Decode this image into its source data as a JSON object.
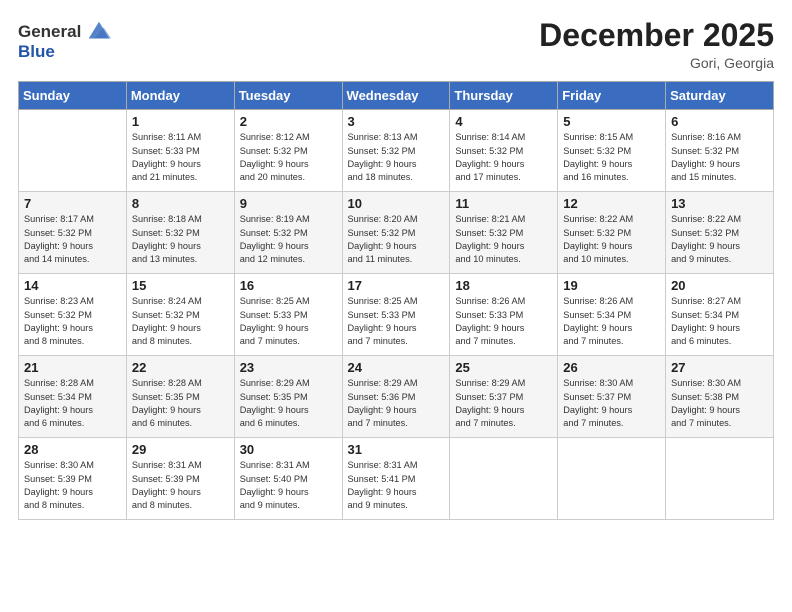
{
  "header": {
    "logo_general": "General",
    "logo_blue": "Blue",
    "month_title": "December 2025",
    "location": "Gori, Georgia"
  },
  "weekdays": [
    "Sunday",
    "Monday",
    "Tuesday",
    "Wednesday",
    "Thursday",
    "Friday",
    "Saturday"
  ],
  "weeks": [
    [
      {
        "day": "",
        "info": ""
      },
      {
        "day": "1",
        "info": "Sunrise: 8:11 AM\nSunset: 5:33 PM\nDaylight: 9 hours\nand 21 minutes."
      },
      {
        "day": "2",
        "info": "Sunrise: 8:12 AM\nSunset: 5:32 PM\nDaylight: 9 hours\nand 20 minutes."
      },
      {
        "day": "3",
        "info": "Sunrise: 8:13 AM\nSunset: 5:32 PM\nDaylight: 9 hours\nand 18 minutes."
      },
      {
        "day": "4",
        "info": "Sunrise: 8:14 AM\nSunset: 5:32 PM\nDaylight: 9 hours\nand 17 minutes."
      },
      {
        "day": "5",
        "info": "Sunrise: 8:15 AM\nSunset: 5:32 PM\nDaylight: 9 hours\nand 16 minutes."
      },
      {
        "day": "6",
        "info": "Sunrise: 8:16 AM\nSunset: 5:32 PM\nDaylight: 9 hours\nand 15 minutes."
      }
    ],
    [
      {
        "day": "7",
        "info": "Sunrise: 8:17 AM\nSunset: 5:32 PM\nDaylight: 9 hours\nand 14 minutes."
      },
      {
        "day": "8",
        "info": "Sunrise: 8:18 AM\nSunset: 5:32 PM\nDaylight: 9 hours\nand 13 minutes."
      },
      {
        "day": "9",
        "info": "Sunrise: 8:19 AM\nSunset: 5:32 PM\nDaylight: 9 hours\nand 12 minutes."
      },
      {
        "day": "10",
        "info": "Sunrise: 8:20 AM\nSunset: 5:32 PM\nDaylight: 9 hours\nand 11 minutes."
      },
      {
        "day": "11",
        "info": "Sunrise: 8:21 AM\nSunset: 5:32 PM\nDaylight: 9 hours\nand 10 minutes."
      },
      {
        "day": "12",
        "info": "Sunrise: 8:22 AM\nSunset: 5:32 PM\nDaylight: 9 hours\nand 10 minutes."
      },
      {
        "day": "13",
        "info": "Sunrise: 8:22 AM\nSunset: 5:32 PM\nDaylight: 9 hours\nand 9 minutes."
      }
    ],
    [
      {
        "day": "14",
        "info": "Sunrise: 8:23 AM\nSunset: 5:32 PM\nDaylight: 9 hours\nand 8 minutes."
      },
      {
        "day": "15",
        "info": "Sunrise: 8:24 AM\nSunset: 5:32 PM\nDaylight: 9 hours\nand 8 minutes."
      },
      {
        "day": "16",
        "info": "Sunrise: 8:25 AM\nSunset: 5:33 PM\nDaylight: 9 hours\nand 7 minutes."
      },
      {
        "day": "17",
        "info": "Sunrise: 8:25 AM\nSunset: 5:33 PM\nDaylight: 9 hours\nand 7 minutes."
      },
      {
        "day": "18",
        "info": "Sunrise: 8:26 AM\nSunset: 5:33 PM\nDaylight: 9 hours\nand 7 minutes."
      },
      {
        "day": "19",
        "info": "Sunrise: 8:26 AM\nSunset: 5:34 PM\nDaylight: 9 hours\nand 7 minutes."
      },
      {
        "day": "20",
        "info": "Sunrise: 8:27 AM\nSunset: 5:34 PM\nDaylight: 9 hours\nand 6 minutes."
      }
    ],
    [
      {
        "day": "21",
        "info": "Sunrise: 8:28 AM\nSunset: 5:34 PM\nDaylight: 9 hours\nand 6 minutes."
      },
      {
        "day": "22",
        "info": "Sunrise: 8:28 AM\nSunset: 5:35 PM\nDaylight: 9 hours\nand 6 minutes."
      },
      {
        "day": "23",
        "info": "Sunrise: 8:29 AM\nSunset: 5:35 PM\nDaylight: 9 hours\nand 6 minutes."
      },
      {
        "day": "24",
        "info": "Sunrise: 8:29 AM\nSunset: 5:36 PM\nDaylight: 9 hours\nand 7 minutes."
      },
      {
        "day": "25",
        "info": "Sunrise: 8:29 AM\nSunset: 5:37 PM\nDaylight: 9 hours\nand 7 minutes."
      },
      {
        "day": "26",
        "info": "Sunrise: 8:30 AM\nSunset: 5:37 PM\nDaylight: 9 hours\nand 7 minutes."
      },
      {
        "day": "27",
        "info": "Sunrise: 8:30 AM\nSunset: 5:38 PM\nDaylight: 9 hours\nand 7 minutes."
      }
    ],
    [
      {
        "day": "28",
        "info": "Sunrise: 8:30 AM\nSunset: 5:39 PM\nDaylight: 9 hours\nand 8 minutes."
      },
      {
        "day": "29",
        "info": "Sunrise: 8:31 AM\nSunset: 5:39 PM\nDaylight: 9 hours\nand 8 minutes."
      },
      {
        "day": "30",
        "info": "Sunrise: 8:31 AM\nSunset: 5:40 PM\nDaylight: 9 hours\nand 9 minutes."
      },
      {
        "day": "31",
        "info": "Sunrise: 8:31 AM\nSunset: 5:41 PM\nDaylight: 9 hours\nand 9 minutes."
      },
      {
        "day": "",
        "info": ""
      },
      {
        "day": "",
        "info": ""
      },
      {
        "day": "",
        "info": ""
      }
    ]
  ]
}
